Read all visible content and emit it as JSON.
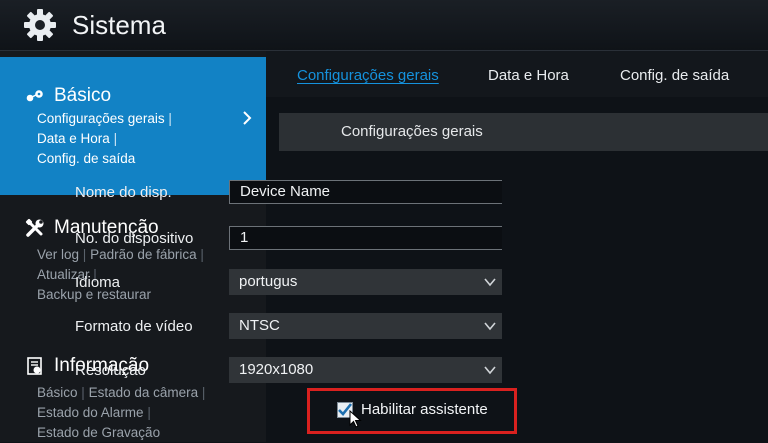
{
  "header": {
    "title": "Sistema",
    "icon": "gear-icon"
  },
  "sidebar": {
    "sections": [
      {
        "label": "Básico",
        "icon": "network-icon",
        "items": [
          "Configurações gerais",
          "Data e Hora",
          "Config. de saída"
        ]
      },
      {
        "label": "Manutenção",
        "icon": "tools-icon",
        "items": [
          "Ver log",
          "Padrão de fábrica",
          "Atualizar",
          "Backup e restaurar"
        ]
      },
      {
        "label": "Informação",
        "icon": "info-icon",
        "items": [
          "Básico",
          "Estado da câmera",
          "Estado do Alarme",
          "Estado de Gravação"
        ]
      }
    ],
    "separator": "|"
  },
  "main": {
    "tabs": [
      "Configurações gerais",
      "Data e Hora",
      "Config. de saída"
    ],
    "panel_title": "Configurações gerais",
    "fields": {
      "device_name": {
        "label": "Nome do disp.",
        "value": "Device Name"
      },
      "device_no": {
        "label": "No. do dispositivo",
        "value": "1"
      },
      "language": {
        "label": "Idioma",
        "value": "portugus"
      },
      "video_format": {
        "label": "Formato de vídeo",
        "value": "NTSC"
      },
      "resolution": {
        "label": "Resolução",
        "value": "1920x1080"
      }
    },
    "wizard": {
      "label": "Habilitar assistente",
      "checked": true
    }
  },
  "colors": {
    "accent": "#1282c5",
    "highlight_box": "#d9211f",
    "active_tab": "#1592dd"
  }
}
